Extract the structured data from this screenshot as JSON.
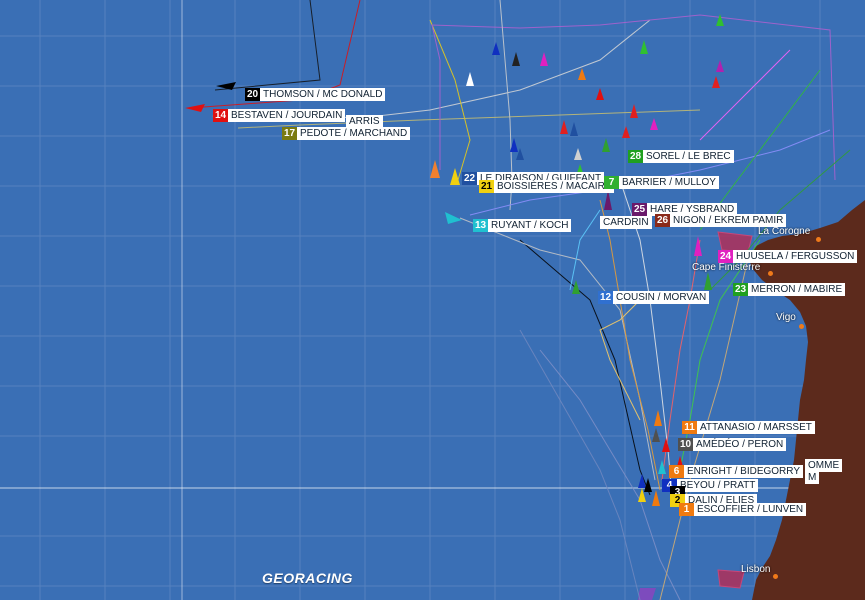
{
  "colors": {
    "sea": "#3a6fb5",
    "land": "#5c2a1c",
    "grid": "#6d93c8",
    "place_dot": "#f07a1a"
  },
  "logo": {
    "text_a": "GEORACING",
    "mark": ""
  },
  "places": [
    {
      "key": "la_coruna",
      "name": "La Corogne"
    },
    {
      "key": "finisterre",
      "name": "Cape Finisterre"
    },
    {
      "key": "vigo",
      "name": "Vigo"
    },
    {
      "key": "lisbon",
      "name": "Lisbon"
    }
  ],
  "boats": [
    {
      "num": "20",
      "name": "THOMSON / MC DONALD",
      "color": "#000000"
    },
    {
      "num": "14",
      "name": "BESTAVEN / JOURDAIN",
      "color": "#e01010"
    },
    {
      "num": "",
      "name": "ARRIS",
      "color": "#ffffff"
    },
    {
      "num": "17",
      "name": "PEDOTE / MARCHAND",
      "color": "#7a7a10"
    },
    {
      "num": "22",
      "name": "LE DIRAISON / GUIFFANT",
      "color": "#2050a0"
    },
    {
      "num": "21",
      "name": "BOISSIÈRES / MACAIRE",
      "color": "#f0d010"
    },
    {
      "num": "28",
      "name": "SOREL / LE BREC",
      "color": "#20a020"
    },
    {
      "num": "7",
      "name": "BARRIER / MULLOY",
      "color": "#30b030"
    },
    {
      "num": "25",
      "name": "HARE / YSBRAND",
      "color": "#6a1a6a"
    },
    {
      "num": "26",
      "name": "NIGON / EKREM PAMIR",
      "color": "#8a2a1a"
    },
    {
      "num": "",
      "name": "CARDRIN",
      "color": "#ffffff"
    },
    {
      "num": "13",
      "name": "RUYANT / KOCH",
      "color": "#20c0d0"
    },
    {
      "num": "24",
      "name": "HUUSELA / FERGUSSON",
      "color": "#e020c0"
    },
    {
      "num": "23",
      "name": "MERRON / MABIRE",
      "color": "#20a020"
    },
    {
      "num": "12",
      "name": "COUSIN / MORVAN",
      "color": "#3070d0"
    },
    {
      "num": "11",
      "name": "ATTANASIO / MARSSET",
      "color": "#f07a10"
    },
    {
      "num": "10",
      "name": "AMÉDÉO / PERON",
      "color": "#505050"
    },
    {
      "num": "",
      "name": "OMME",
      "color": "#ffffff"
    },
    {
      "num": "6",
      "name": "ENRIGHT / BIDEGORRY",
      "color": "#f07a10"
    },
    {
      "num": "",
      "name": "M",
      "color": "#ffffff"
    },
    {
      "num": "4",
      "name": "BEYOU / PRATT",
      "color": "#1030c0"
    },
    {
      "num": "3",
      "name": "",
      "color": "#000000"
    },
    {
      "num": "2",
      "name": "DALIN / ELIES",
      "color": "#f0d010"
    },
    {
      "num": "1",
      "name": "ESCOFFIER / LUNVEN",
      "color": "#f07a10"
    }
  ]
}
